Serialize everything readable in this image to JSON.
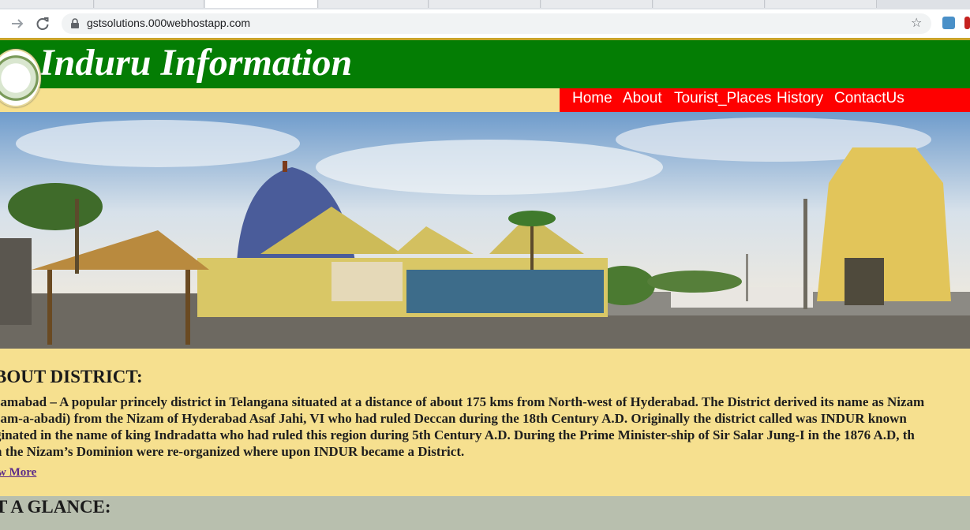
{
  "browser": {
    "url": "gstsolutions.000webhostapp.com",
    "icons": {
      "back": "back-arrow-icon",
      "forward": "forward-arrow-icon",
      "reload": "reload-icon",
      "lock": "lock-icon",
      "bookmark": "star-icon"
    }
  },
  "header": {
    "title": "Induru Information",
    "emblem": "telangana-state-emblem",
    "colors": {
      "header_bg": "#047d04",
      "nav_bg": "#fe0000",
      "page_bg": "#f6e08f",
      "glance_bg": "#b8bfae"
    }
  },
  "nav": {
    "items": [
      "Home",
      "About",
      "Tourist_Places",
      "History",
      "ContactUs"
    ]
  },
  "about": {
    "heading": "BOUT DISTRICT:",
    "lines": [
      "zamabad – A popular princely district in Telangana situated at a distance of about 175 kms from North-west of Hyderabad. The District derived its name as Nizam",
      "zam-a-abadi) from the Nizam of Hyderabad Asaf Jahi, VI who had ruled Deccan during the 18th Century A.D. Originally the district called was INDUR known",
      "ginated in the name of king Indradatta who had ruled this region during 5th Century A.D. During the Prime Minister-ship of Sir Salar Jung-I in the 1876 A.D, th",
      "n the Nizam’s Dominion were re-organized where upon INDUR became a District."
    ],
    "more_link": "w More"
  },
  "glance": {
    "heading": "T A GLANCE:"
  }
}
